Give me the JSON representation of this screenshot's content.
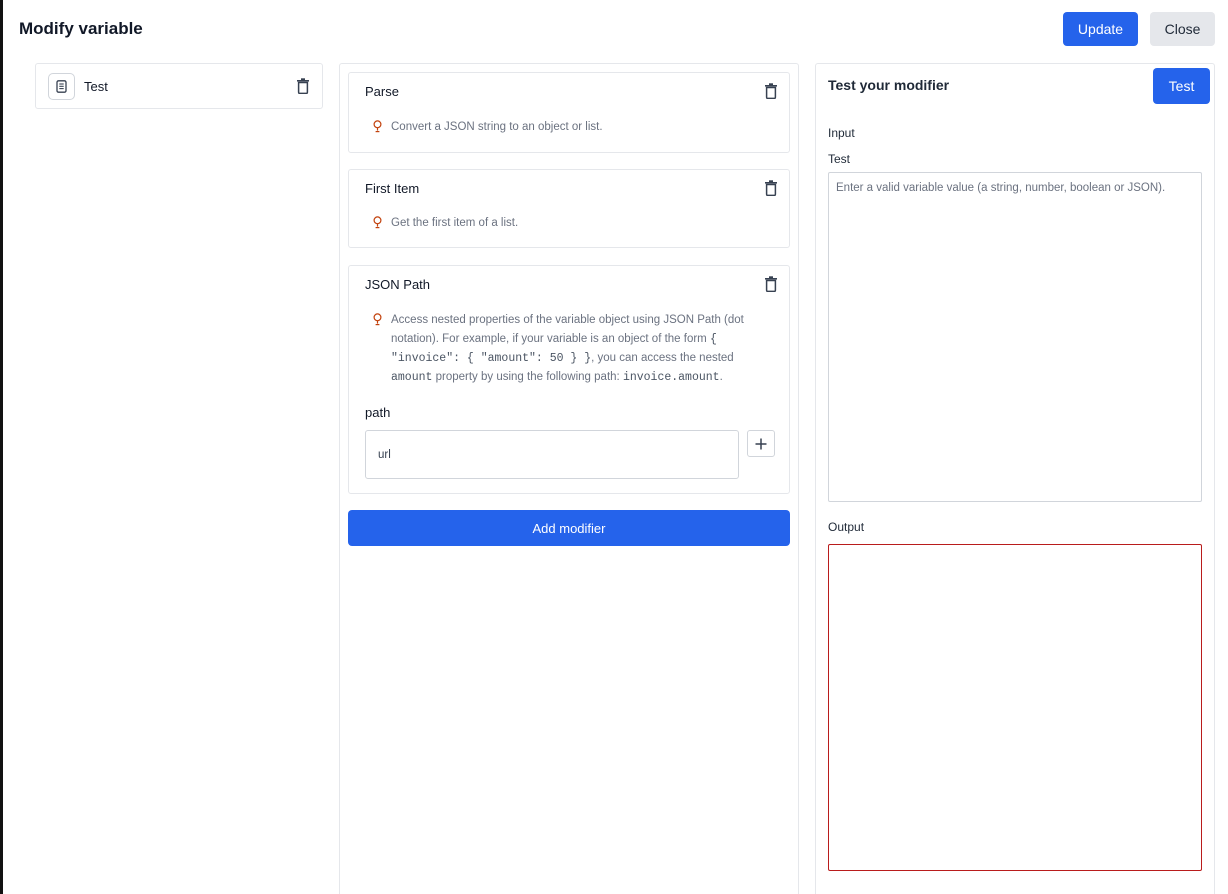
{
  "header": {
    "title": "Modify variable",
    "update_label": "Update",
    "close_label": "Close"
  },
  "variable": {
    "name": "Test"
  },
  "modifiers": [
    {
      "title": "Parse",
      "description": "Convert a JSON string to an object or list."
    },
    {
      "title": "First Item",
      "description": "Get the first item of a list."
    },
    {
      "title": "JSON Path",
      "description_parts": {
        "p1": "Access nested properties of the variable object using JSON Path (dot notation). For example, if your variable is an object of the form ",
        "code1": "{ \"invoice\": { \"amount\": 50 } }",
        "p2": ", you can access the nested ",
        "code2": "amount",
        "p3": " property by using the following path: ",
        "code3": "invoice.amount",
        "p4": "."
      },
      "field_label": "path",
      "field_value": "url"
    }
  ],
  "add_modifier_label": "Add modifier",
  "test_panel": {
    "title": "Test your modifier",
    "test_button_label": "Test",
    "input_section_label": "Input",
    "input_field_label": "Test",
    "input_placeholder": "Enter a valid variable value (a string, number, boolean or JSON).",
    "output_label": "Output"
  },
  "colors": {
    "primary": "#2563eb",
    "output_border": "#b91c1c",
    "hint_icon": "#c2410c"
  }
}
